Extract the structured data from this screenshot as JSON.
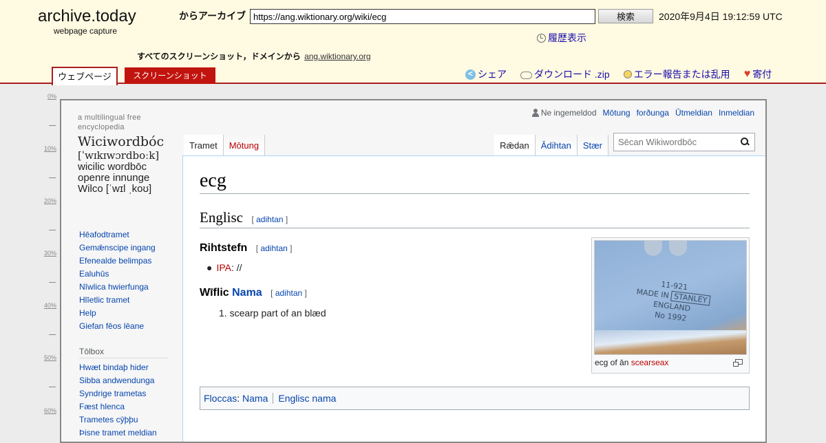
{
  "archive": {
    "site_name": "archive.today",
    "site_subtitle": "webpage capture",
    "from_label": "からアーカイブ",
    "url_value": "https://ang.wiktionary.org/wiki/ecg",
    "search_button": "検索",
    "timestamp": "2020年9月4日 19:12:59 UTC",
    "history_link": "履歴表示",
    "screenshots_label": "すべてのスクリーンショット，ドメインから",
    "domain_link": "ang.wiktionary.org",
    "tabs": {
      "webpage": "ウェブページ",
      "screenshot": "スクリーンショット"
    },
    "actions": [
      {
        "label": "シェア",
        "icon": "share-icon"
      },
      {
        "label": "ダウンロード .zip",
        "icon": "cloud-download-icon"
      },
      {
        "label": "エラー報告または乱用",
        "icon": "lightbulb-icon"
      },
      {
        "label": "寄付",
        "icon": "heart-icon"
      }
    ],
    "ruler_labels": [
      "0%",
      "10%",
      "20%",
      "30%",
      "40%",
      "50%",
      "60%"
    ],
    "colors": {
      "header_bg": "#fffae2",
      "accent_red": "#c2140f",
      "link_blue": "#1a0dab"
    }
  },
  "wiki": {
    "personal": {
      "anon": "Ne ingemeldod",
      "links": [
        "Mōtung",
        "forðunga",
        "Ūtmeldian",
        "Inmeldian"
      ]
    },
    "logo": {
      "tagline": [
        "a multilingual free",
        "encyclopedia"
      ],
      "wordmark": "Wiciwordbóc",
      "ipa": "[ˈwɪkɪwɔrdboːk]",
      "lines": [
        "wicilic wordbōc",
        "openre innunge",
        "Wilco [ˈwɪl ˌkoʊ]"
      ]
    },
    "nav": [
      "Hēafodtramet",
      "Gemǣnscipe ingang",
      "Efenealde belimpas",
      "Ealuhūs",
      "Nīwlica hwierfunga",
      "Hlīetlic tramet",
      "Help",
      "Giefan fēos lēane"
    ],
    "toolbox_heading": "Tōlbox",
    "toolbox": [
      "Hwæt bindaþ hider",
      "Sibba andwendunga",
      "Syndrige trametas",
      "Fæst hlenca",
      "Trametes cȳþþu",
      "Þisne tramet meldian"
    ],
    "tabs_left": [
      "Tramet",
      "Mōtung"
    ],
    "tabs_right": [
      "Rǣdan",
      "Ādihtan",
      "Stær"
    ],
    "search_placeholder": "Sēcan Wikiwordbōc",
    "title": "ecg",
    "section_heading": "Englisc",
    "edit_label": "adihtan",
    "pronunciation_heading": "Rihtstefn",
    "ipa_label": "IPA",
    "ipa_value": ": //",
    "pos_prefix": "Wīflic",
    "pos_link": "Nama",
    "definition": "1. scearp part of an blæd",
    "thumb": {
      "stamp_top": "11-921",
      "stamp_left": "MADE IN",
      "stamp_box": "STANLEY",
      "stamp_right": "ENGLAND",
      "stamp_bottom": "No 1992",
      "caption_prefix": "ecg of ān ",
      "caption_link": "scearseax"
    },
    "categories_label": "Floccas",
    "categories": [
      "Nama",
      "Englisc nama"
    ],
    "colors": {
      "link": "#0645ad",
      "redlink": "#ba0000"
    }
  }
}
